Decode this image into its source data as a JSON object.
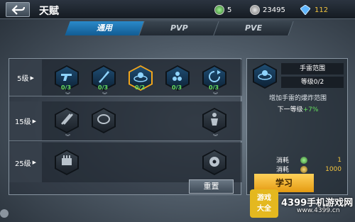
{
  "header": {
    "title": "天赋",
    "resources": [
      {
        "icon": "green-coin-icon",
        "value": "5"
      },
      {
        "icon": "silver-coin-icon",
        "value": "23495"
      },
      {
        "icon": "diamond-icon",
        "value": "112"
      }
    ]
  },
  "tabs": [
    {
      "label": "通用",
      "active": true
    },
    {
      "label": "PVP",
      "active": false
    },
    {
      "label": "PVE",
      "active": false
    }
  ],
  "talent_grid": {
    "rows": [
      {
        "label": "5级",
        "slots": [
          {
            "icon": "pistol-icon",
            "count": "0/3"
          },
          {
            "icon": "knife-icon",
            "count": "0/3"
          },
          {
            "icon": "grenade-range-icon",
            "count": "0/2",
            "selected": true
          },
          {
            "icon": "ammo-icon",
            "count": "0/3"
          },
          {
            "icon": "reload-icon",
            "count": "0/3"
          }
        ]
      },
      {
        "label": "15级",
        "slots": [
          {
            "icon": "dual-weapon-icon"
          },
          {
            "icon": "belt-icon"
          },
          {
            "icon": "soldier-icon"
          }
        ]
      },
      {
        "label": "25级",
        "slots": [
          {
            "icon": "ammo-box-icon"
          },
          {
            "icon": "mine-icon"
          }
        ]
      }
    ],
    "reset_label": "重置"
  },
  "detail": {
    "name": "手雷范围",
    "level": "等级0/2",
    "description": "增加手雷的爆炸范围",
    "next_prefix": "下一等级",
    "next_value": "+7%",
    "costs": [
      {
        "label": "消耗",
        "icon": "green-coin-icon",
        "value": "1"
      },
      {
        "label": "消耗",
        "icon": "gold-coin-icon",
        "value": "1000"
      }
    ],
    "learn_label": "学习"
  },
  "watermark": {
    "logo_line1": "游戏",
    "logo_line2": "大全",
    "text": "4399手机游戏网",
    "url": "www.4399.cn"
  },
  "colors": {
    "accent_blue": "#2a89c9",
    "selected_gold": "#f2a51b",
    "learn_gold": "#ffd15a",
    "count_green": "#66e060"
  }
}
